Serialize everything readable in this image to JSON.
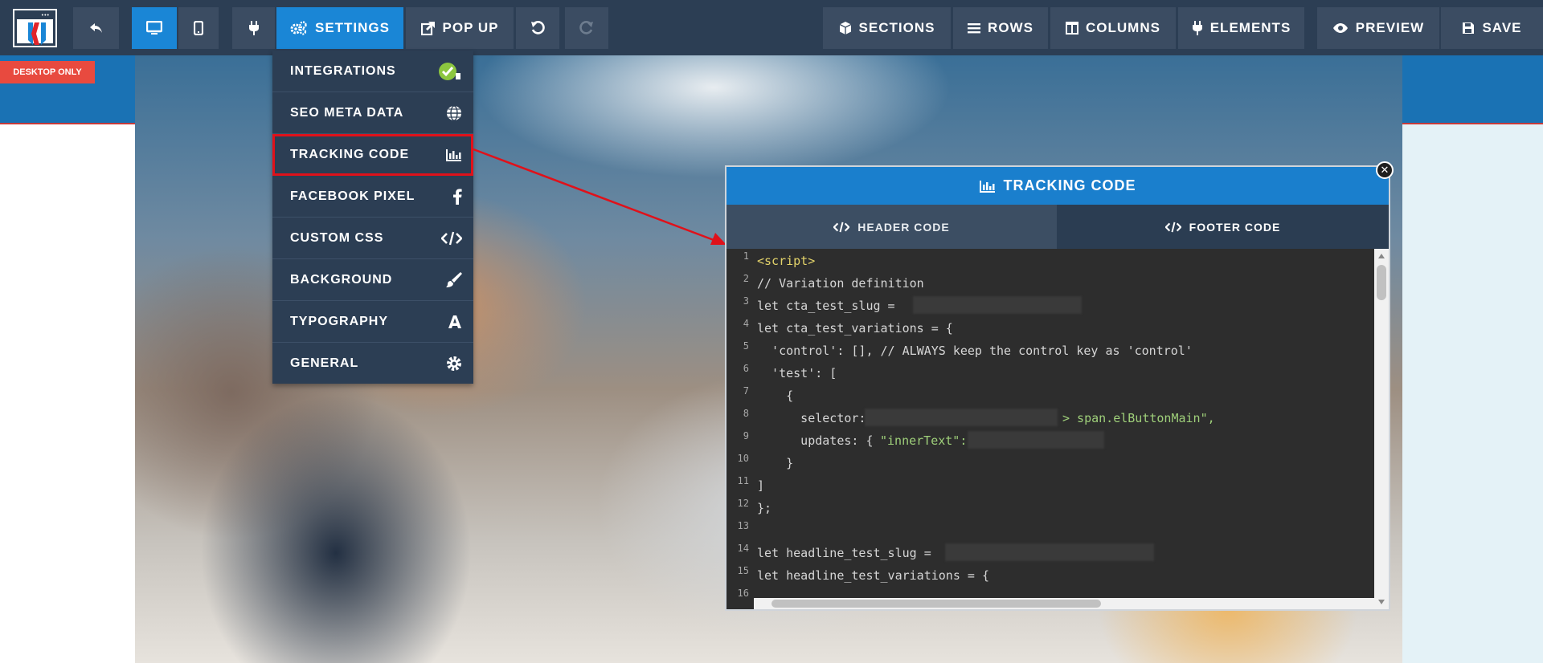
{
  "toolbar": {
    "settings_label": "SETTINGS",
    "popup_label": "POP UP",
    "sections_label": "SECTIONS",
    "rows_label": "ROWS",
    "columns_label": "COLUMNS",
    "elements_label": "ELEMENTS",
    "preview_label": "PREVIEW",
    "save_label": "SAVE"
  },
  "badge": {
    "label": "DESKTOP ONLY"
  },
  "settings_menu": {
    "items": [
      {
        "label": "INTEGRATIONS",
        "icon": "check-circle-icon"
      },
      {
        "label": "SEO META DATA",
        "icon": "globe-icon"
      },
      {
        "label": "TRACKING CODE",
        "icon": "bar-chart-icon"
      },
      {
        "label": "FACEBOOK PIXEL",
        "icon": "facebook-icon"
      },
      {
        "label": "CUSTOM CSS",
        "icon": "code-icon"
      },
      {
        "label": "BACKGROUND",
        "icon": "brush-icon"
      },
      {
        "label": "TYPOGRAPHY",
        "icon": "font-icon"
      },
      {
        "label": "GENERAL",
        "icon": "gear-icon"
      }
    ]
  },
  "modal": {
    "title": "TRACKING CODE",
    "tabs": {
      "header": "HEADER CODE",
      "footer": "FOOTER CODE"
    },
    "lines": [
      {
        "n": "1",
        "text": "<script>"
      },
      {
        "n": "2",
        "text": "// Variation definition"
      },
      {
        "n": "3",
        "text": "let cta_test_slug = "
      },
      {
        "n": "4",
        "text": "let cta_test_variations = {"
      },
      {
        "n": "5",
        "text": "  'control': [], // ALWAYS keep the control key as 'control'"
      },
      {
        "n": "6",
        "text": "  'test': ["
      },
      {
        "n": "7",
        "text": "    {"
      },
      {
        "n": "8a",
        "text": "      selector: "
      },
      {
        "n": "8b",
        "text": "> span.elButtonMain\","
      },
      {
        "n": "9a",
        "text": "      updates: {"
      },
      {
        "n": "9b",
        "text": "\"innerText\":"
      },
      {
        "n": "10",
        "text": "    }"
      },
      {
        "n": "11",
        "text": "]"
      },
      {
        "n": "12",
        "text": "};"
      },
      {
        "n": "13",
        "text": ""
      },
      {
        "n": "14",
        "text": "let headline_test_slug = "
      },
      {
        "n": "15",
        "text": "let headline_test_variations = {"
      },
      {
        "n": "16",
        "text": ""
      }
    ],
    "line_numbers": [
      "1",
      "2",
      "3",
      "4",
      "5",
      "6",
      "7",
      "8",
      "9",
      "10",
      "11",
      "12",
      "13",
      "14",
      "15",
      "16"
    ]
  },
  "colors": {
    "toolbar_bg": "#2c3e54",
    "active_blue": "#1a86d6",
    "highlight_red": "#e0111a",
    "badge_red": "#e84a3f"
  }
}
